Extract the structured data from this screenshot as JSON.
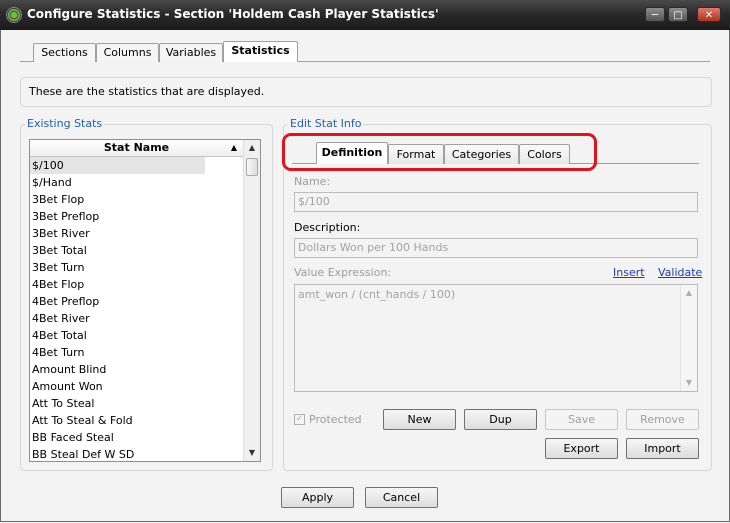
{
  "window": {
    "title": "Configure Statistics - Section 'Holdem Cash Player Statistics'",
    "controls": [
      "minimize",
      "maximize",
      "close"
    ]
  },
  "top_tabs": [
    {
      "label": "Sections",
      "active": false
    },
    {
      "label": "Columns",
      "active": false
    },
    {
      "label": "Variables",
      "active": false
    },
    {
      "label": "Statistics",
      "active": true
    }
  ],
  "info_text": "These are the statistics that are displayed.",
  "existing_stats": {
    "group_label": "Existing Stats",
    "column_header": "Stat Name",
    "items": [
      "$/100",
      "$/Hand",
      "3Bet Flop",
      "3Bet Preflop",
      "3Bet River",
      "3Bet Total",
      "3Bet Turn",
      "4Bet Flop",
      "4Bet Preflop",
      "4Bet River",
      "4Bet Total",
      "4Bet Turn",
      "Amount Blind",
      "Amount Won",
      "Att To Steal",
      "Att To Steal & Fold",
      "BB Faced Steal",
      "BB Steal Def W SD"
    ],
    "selected": "$/100"
  },
  "edit_stat_info": {
    "group_label": "Edit Stat Info",
    "tabs": [
      {
        "label": "Definition",
        "active": true
      },
      {
        "label": "Format",
        "active": false
      },
      {
        "label": "Categories",
        "active": false
      },
      {
        "label": "Colors",
        "active": false
      }
    ],
    "name_label": "Name:",
    "name_value": "$/100",
    "description_label": "Description:",
    "description_value": "Dollars Won per 100 Hands",
    "value_expression_label": "Value Expression:",
    "insert_link": "Insert",
    "validate_link": "Validate",
    "value_expression": "amt_won / (cnt_hands / 100)",
    "protected_label": "Protected",
    "protected_checked": true,
    "buttons": {
      "new": "New",
      "dup": "Dup",
      "save": "Save",
      "remove": "Remove",
      "export": "Export",
      "import": "Import"
    }
  },
  "footer": {
    "apply": "Apply",
    "cancel": "Cancel"
  },
  "colors": {
    "group_label": "#1f5fb3",
    "highlight": "#e0141e",
    "title_bar": "#2a2a2a"
  }
}
